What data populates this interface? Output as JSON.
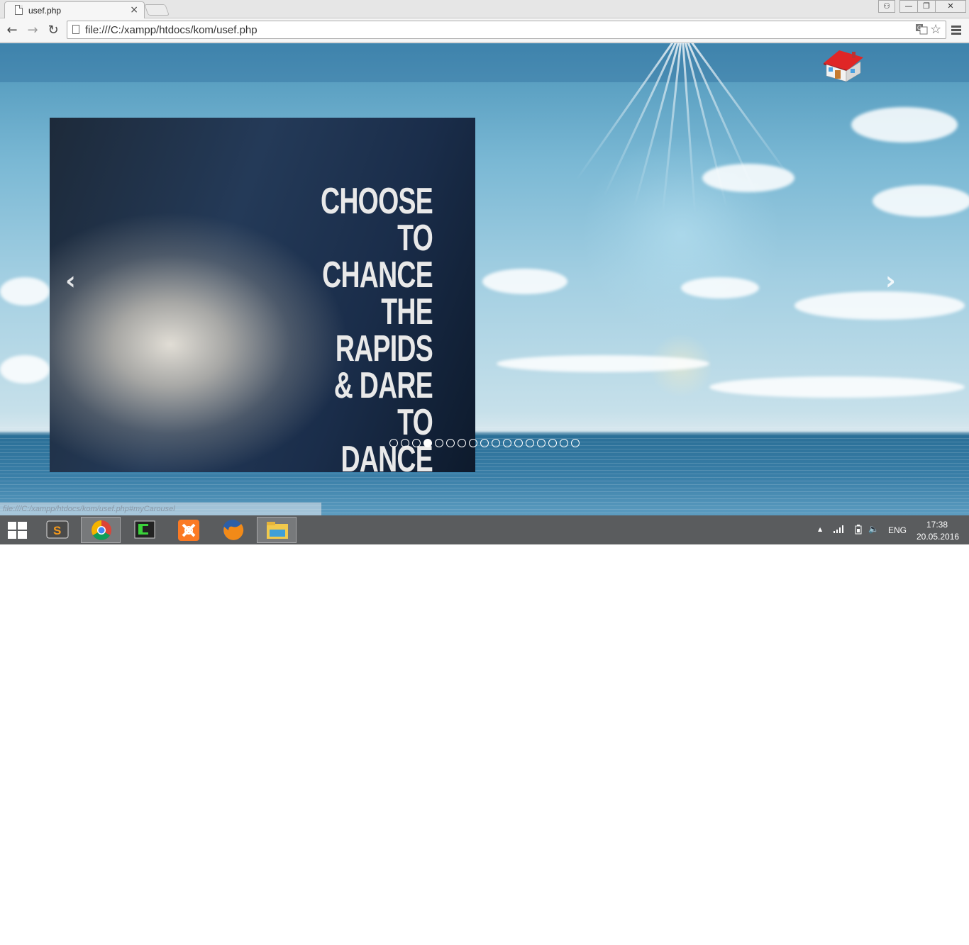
{
  "browser": {
    "tab_title": "usef.php",
    "tab_close": "×",
    "url": "file:///C:/xampp/htdocs/kom/usef.php",
    "back": "←",
    "forward": "→",
    "reload": "↻",
    "translate_icon": "translate-icon",
    "star_icon": "☆",
    "window_controls": {
      "user": "⚇",
      "minimize": "—",
      "restore": "❐",
      "close": "✕"
    }
  },
  "page": {
    "home_icon": "house-icon",
    "carousel": {
      "caption": "CHOOSE\nTO CHANCE\nTHE RAPIDS\n& DARE TO\nDANCE THE\nTIDES.",
      "prev_arrow": "‹",
      "next_arrow": "›",
      "indicator_count": 17,
      "active_index": 3
    },
    "status_bar_url": "file:///C:/xampp/htdocs/kom/usef.php#myCarousel"
  },
  "taskbar": {
    "apps": [
      "start-icon",
      "sublime-text-icon",
      "chrome-icon",
      "terminal-icon",
      "xampp-icon",
      "firefox-icon",
      "file-explorer-icon"
    ],
    "language": "ENG",
    "time": "17:38",
    "date": "20.05.2016",
    "tray_up": "▲",
    "volume": "🔈"
  },
  "colors": {
    "sky": "#7ab8d4",
    "sea": "#2a6f97",
    "taskbar": "#5a5c5e",
    "chrome_toolbar": "#f6f6f6"
  }
}
